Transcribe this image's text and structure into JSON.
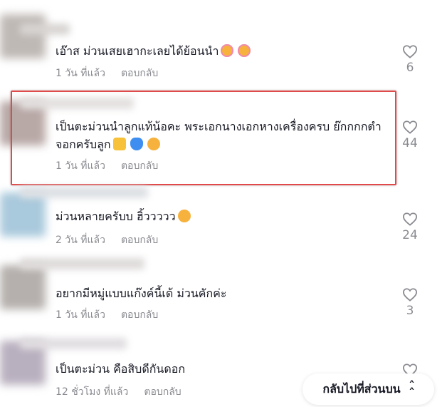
{
  "comments": [
    {
      "text": "เอ๊าส ม่วนเสยเฮากะเลยได้ย้อนนำ",
      "emojis": [
        "smiling-face-with-hearts",
        "smiling-face-with-hearts"
      ],
      "time": "1 วัน ที่แล้ว",
      "reply_label": "ตอบกลับ",
      "likes": "6",
      "highlighted": false
    },
    {
      "text": "เป็นตะม่วนนำลูกแท้น้อคะ พระเอกนางเอกหางเครื่องครบ ย๊กกกกตำจอกครับลูก",
      "emojis": [
        "heart-hands",
        "blue-heart",
        "smiling-face-with-smiling-eyes"
      ],
      "time": "1 วัน ที่แล้ว",
      "reply_label": "ตอบกลับ",
      "likes": "44",
      "highlighted": true
    },
    {
      "text": "ม่วนหลายครับบ ฮิ้ววววว",
      "emojis": [
        "smiling-face-with-smiling-eyes"
      ],
      "time": "2 วัน ที่แล้ว",
      "reply_label": "ตอบกลับ",
      "likes": "24",
      "highlighted": false
    },
    {
      "text": "อยากมีหมู่แบบแก๊งค์นี้เด้ ม่วนคักค่ะ",
      "emojis": [],
      "time": "1 วัน ที่แล้ว",
      "reply_label": "ตอบกลับ",
      "likes": "3",
      "highlighted": false
    },
    {
      "text": "เป็นตะม่วน คือสิบดีกันดอก",
      "emojis": [],
      "time": "12 ชั่วโมง ที่แล้ว",
      "reply_label": "ตอบกลับ",
      "likes": "",
      "highlighted": false
    }
  ],
  "back_to_top": {
    "label": "กลับไปที่ส่วนบน",
    "icon": "double-chevron-up-icon"
  },
  "colors": {
    "highlight_border": "#e04a4a",
    "meta_text": "#8a8b91",
    "main_text": "#161823"
  }
}
